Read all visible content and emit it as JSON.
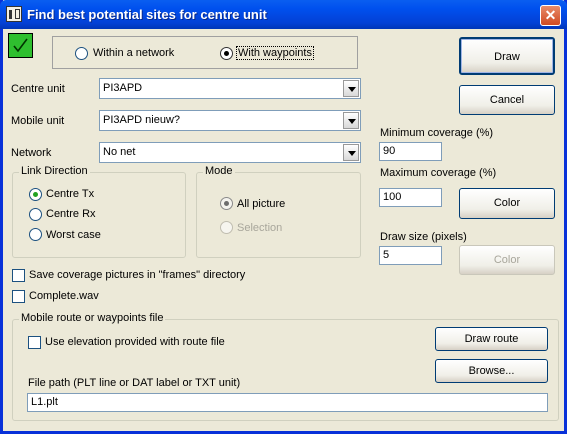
{
  "window": {
    "title": "Find best potential sites for centre unit",
    "close_glyph": "✕"
  },
  "status_icon": {
    "name": "checkmark-icon",
    "color": "#2fbf2f"
  },
  "mode_toggle": {
    "options": [
      {
        "label": "Within a network",
        "selected": false
      },
      {
        "label": "With waypoints",
        "selected": true
      }
    ]
  },
  "fields": {
    "centre_unit": {
      "label": "Centre unit",
      "value": "PI3APD"
    },
    "mobile_unit": {
      "label": "Mobile unit",
      "value": "PI3APD nieuw?"
    },
    "network": {
      "label": "Network",
      "value": "No net"
    }
  },
  "link_direction": {
    "title": "Link Direction",
    "options": [
      {
        "label": "Centre Tx",
        "selected": true
      },
      {
        "label": "Centre Rx",
        "selected": false
      },
      {
        "label": "Worst case",
        "selected": false
      }
    ]
  },
  "mode": {
    "title": "Mode",
    "options": [
      {
        "label": "All picture",
        "selected": true,
        "enabled": true
      },
      {
        "label": "Selection",
        "selected": false,
        "enabled": false
      }
    ]
  },
  "checkboxes": {
    "save_frames": {
      "label": "Save coverage pictures in \"frames\" directory",
      "checked": false
    },
    "complete_wav": {
      "label": "Complete.wav",
      "checked": false
    }
  },
  "buttons": {
    "draw": "Draw",
    "cancel": "Cancel",
    "color_enabled": "Color",
    "color_disabled": "Color",
    "draw_route": "Draw route",
    "browse": "Browse..."
  },
  "coverage": {
    "min_label": "Minimum coverage (%)",
    "min_value": "90",
    "max_label": "Maximum coverage (%)",
    "max_value": "100",
    "size_label": "Draw size (pixels)",
    "size_value": "5"
  },
  "route": {
    "group_title": "Mobile route or waypoints file",
    "elevation_label": "Use elevation provided with route file",
    "elevation_checked": false,
    "file_label": "File path (PLT line or DAT label or TXT unit)",
    "file_value": "L1.plt"
  }
}
